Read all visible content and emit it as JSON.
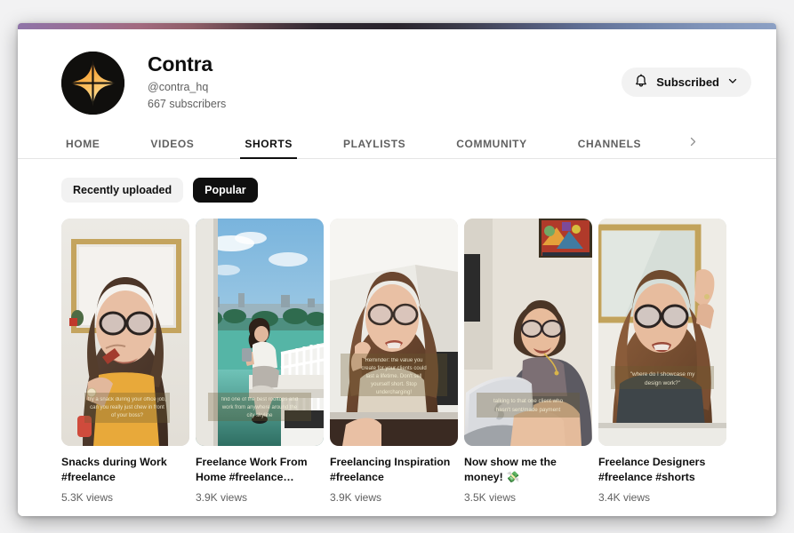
{
  "window": {
    "wallpaper_strip_colors": [
      "#8f74a8",
      "#a26a7f",
      "#2e2730",
      "#5f6e93",
      "#8ca0c4"
    ]
  },
  "channel": {
    "name": "Contra",
    "handle": "@contra_hq",
    "subscribers": "667 subscribers",
    "avatar_icon": "four-point-star-logo",
    "avatar_bg": "#100f0d",
    "avatar_gradient": [
      "#f08a3c",
      "#f9b44a",
      "#fde08a"
    ],
    "subscribe": {
      "label": "Subscribed",
      "bell_icon": "bell-icon",
      "chevron_icon": "chevron-down-icon"
    }
  },
  "tabs": [
    {
      "label": "HOME",
      "active": false
    },
    {
      "label": "VIDEOS",
      "active": false
    },
    {
      "label": "SHORTS",
      "active": true
    },
    {
      "label": "PLAYLISTS",
      "active": false
    },
    {
      "label": "COMMUNITY",
      "active": false
    },
    {
      "label": "CHANNELS",
      "active": false
    }
  ],
  "tabs_more_icon": "chevron-right-icon",
  "filters": [
    {
      "label": "Recently uploaded",
      "active": false
    },
    {
      "label": "Popular",
      "active": true
    }
  ],
  "shorts": [
    {
      "title": "Snacks during Work #freelance",
      "views": "5.3K views",
      "caption": "try a snack during your office job, can you really just chew in front of your boss?",
      "scene": "indoor-portrait-snack"
    },
    {
      "title": "Freelance Work From Home #freelance…",
      "views": "3.9K views",
      "caption": "find one of the best rooftops and work from anywhere around the city skyline",
      "scene": "rooftop-terrace"
    },
    {
      "title": "Freelancing Inspiration #freelance",
      "views": "3.9K views",
      "caption": "Reminder: the value you create for your clients could last a lifetime. Don't sell yourself short. Stop undercharging!",
      "scene": "desk-portrait"
    },
    {
      "title": "Now show me the money! 💸",
      "views": "3.5K views",
      "caption": "talking to that one client who hasn't sent/made payment",
      "scene": "laptop-couch"
    },
    {
      "title": "Freelance Designers #freelance #shorts",
      "views": "3.4K views",
      "caption": "where do I showcase my design work?",
      "scene": "mirror-portrait"
    }
  ]
}
